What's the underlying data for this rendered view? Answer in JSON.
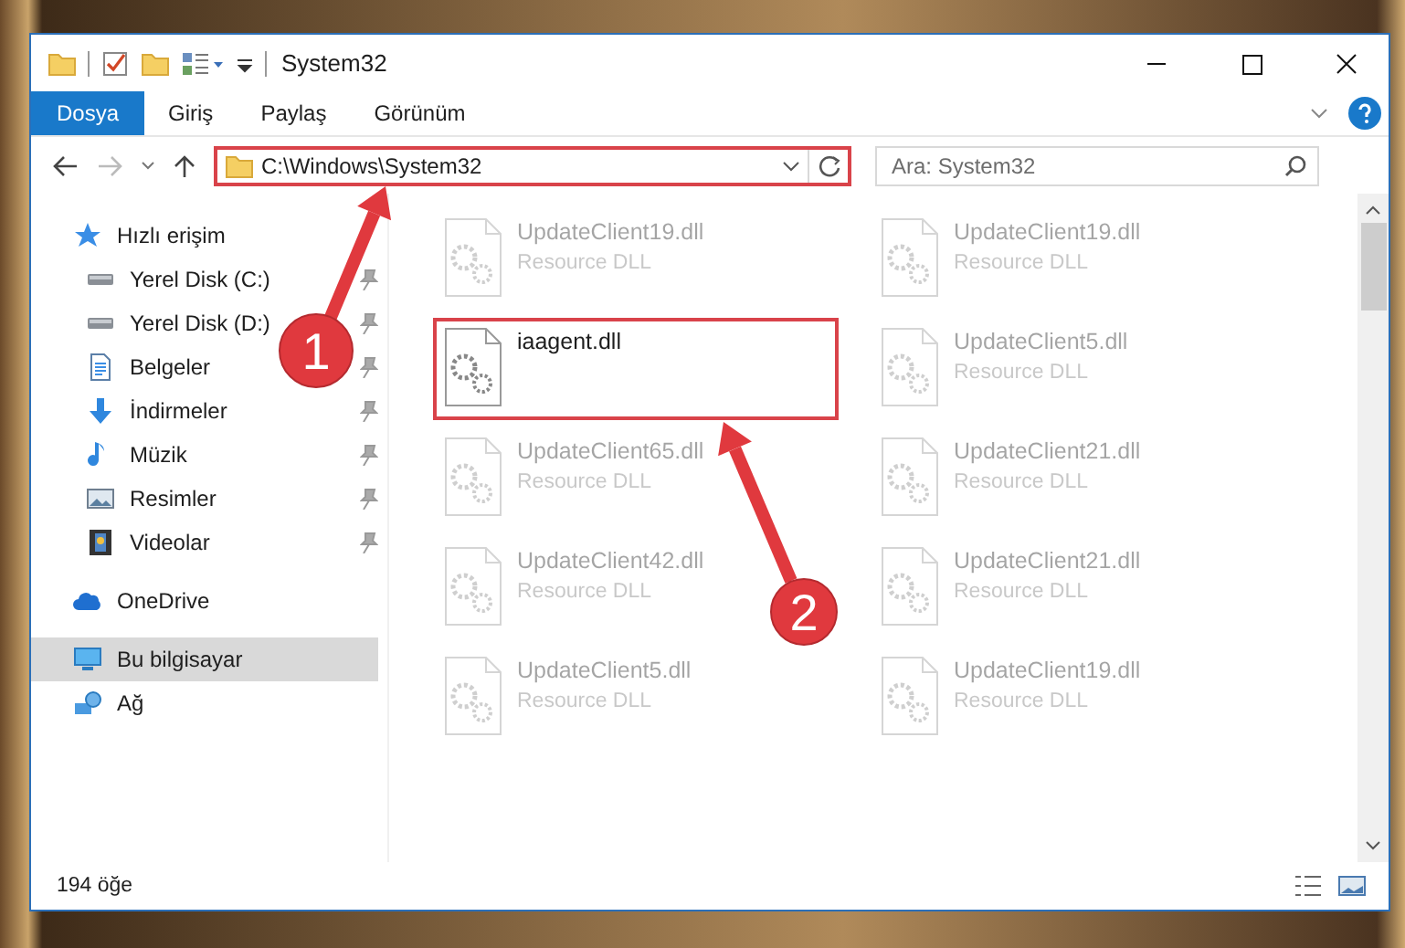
{
  "window": {
    "title": "System32"
  },
  "ribbon": {
    "tabs": [
      {
        "label": "Dosya",
        "selected": true
      },
      {
        "label": "Giriş",
        "selected": false
      },
      {
        "label": "Paylaş",
        "selected": false
      },
      {
        "label": "Görünüm",
        "selected": false
      }
    ]
  },
  "address_bar": {
    "path": "C:\\Windows\\System32",
    "highlighted": true
  },
  "search": {
    "placeholder": "Ara: System32"
  },
  "sidebar": {
    "items": [
      {
        "label": "Hızlı erişim",
        "kind": "star",
        "selected": false,
        "children": [
          {
            "label": "Yerel Disk (C:)",
            "kind": "drive",
            "pinned": true,
            "selected": false
          },
          {
            "label": "Yerel Disk (D:)",
            "kind": "drive",
            "pinned": true,
            "selected": false
          },
          {
            "label": "Belgeler",
            "kind": "document",
            "pinned": true,
            "selected": false
          },
          {
            "label": "İndirmeler",
            "kind": "download",
            "pinned": true,
            "selected": false
          },
          {
            "label": "Müzik",
            "kind": "music",
            "pinned": true,
            "selected": false
          },
          {
            "label": "Resimler",
            "kind": "picture",
            "pinned": true,
            "selected": false
          },
          {
            "label": "Videolar",
            "kind": "video",
            "pinned": true,
            "selected": false
          }
        ]
      },
      {
        "label": "OneDrive",
        "kind": "cloud",
        "selected": false
      },
      {
        "label": "Bu bilgisayar",
        "kind": "computer",
        "selected": true
      },
      {
        "label": "Ağ",
        "kind": "network",
        "selected": false
      }
    ]
  },
  "files": [
    {
      "name": "UpdateClient19.dll",
      "type": "Resource DLL",
      "faded": true,
      "highlighted": false
    },
    {
      "name": "UpdateClient19.dll",
      "type": "Resource DLL",
      "faded": true,
      "highlighted": false
    },
    {
      "name": "iaagent.dll",
      "faded": false,
      "highlighted": true
    },
    {
      "name": "UpdateClient5.dll",
      "type": "Resource DLL",
      "faded": true,
      "highlighted": false
    },
    {
      "name": "UpdateClient65.dll",
      "type": "Resource DLL",
      "faded": true,
      "highlighted": false
    },
    {
      "name": "UpdateClient21.dll",
      "type": "Resource DLL",
      "faded": true,
      "highlighted": false
    },
    {
      "name": "UpdateClient42.dll",
      "type": "Resource DLL",
      "faded": true,
      "highlighted": false
    },
    {
      "name": "UpdateClient21.dll",
      "type": "Resource DLL",
      "faded": true,
      "highlighted": false
    },
    {
      "name": "UpdateClient5.dll",
      "type": "Resource DLL",
      "faded": true,
      "highlighted": false
    },
    {
      "name": "UpdateClient19.dll",
      "type": "Resource DLL",
      "faded": true,
      "highlighted": false
    }
  ],
  "status_bar": {
    "count": "194 öğe"
  },
  "callouts": [
    {
      "number": "1"
    },
    {
      "number": "2"
    }
  ]
}
